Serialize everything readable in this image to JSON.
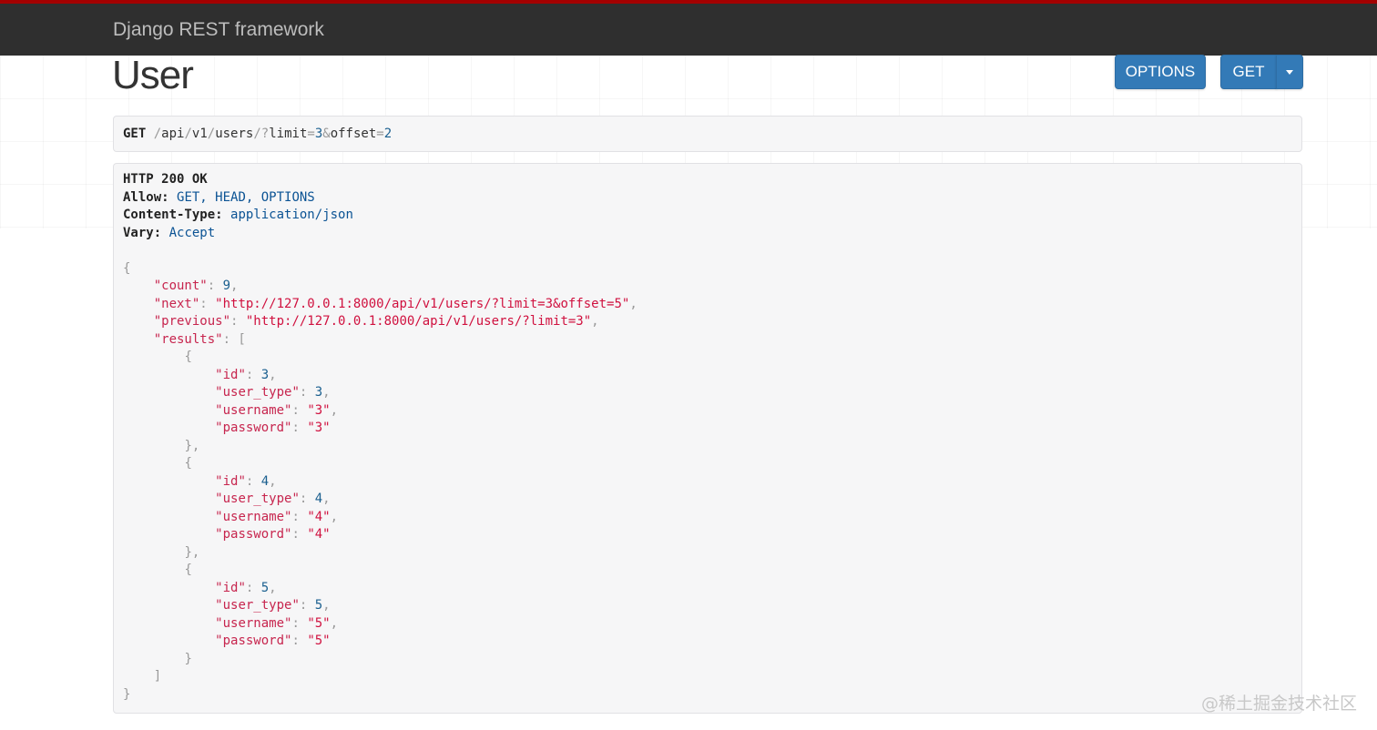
{
  "navbar": {
    "brand": "Django REST framework"
  },
  "page": {
    "title": "User"
  },
  "buttons": {
    "options_label": "OPTIONS",
    "get_label": "GET"
  },
  "request": {
    "method": "GET",
    "path_segments": [
      "/",
      "api",
      "/",
      "v1",
      "/",
      "users",
      "/",
      "?",
      "limit",
      "=",
      "3",
      "&",
      "offset",
      "=",
      "2"
    ]
  },
  "response": {
    "status": "HTTP 200 OK",
    "headers": [
      {
        "name": "Allow:",
        "value": "GET, HEAD, OPTIONS"
      },
      {
        "name": "Content-Type:",
        "value": "application/json"
      },
      {
        "name": "Vary:",
        "value": "Accept"
      }
    ],
    "count_key": "\"count\"",
    "count_value": "9",
    "next_key": "\"next\"",
    "next_value": "\"http://127.0.0.1:8000/api/v1/users/?limit=3&offset=5\"",
    "previous_key": "\"previous\"",
    "previous_value": "\"http://127.0.0.1:8000/api/v1/users/?limit=3\"",
    "results_key": "\"results\"",
    "results": [
      {
        "id": "3",
        "user_type": "3",
        "username": "\"3\"",
        "password": "\"3\""
      },
      {
        "id": "4",
        "user_type": "4",
        "username": "\"4\"",
        "password": "\"4\""
      },
      {
        "id": "5",
        "user_type": "5",
        "username": "\"5\"",
        "password": "\"5\""
      }
    ],
    "field_keys": {
      "id": "\"id\"",
      "user_type": "\"user_type\"",
      "username": "\"username\"",
      "password": "\"password\""
    }
  },
  "watermark": "@稀土掘金技术社区"
}
